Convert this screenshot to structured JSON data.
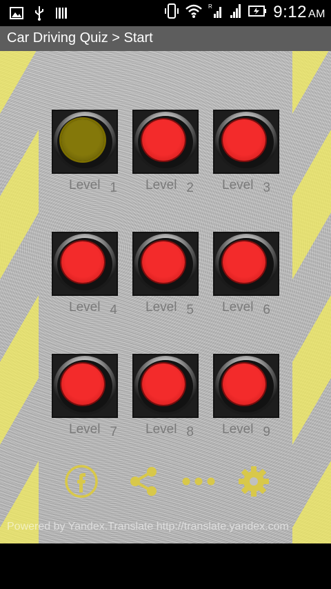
{
  "status_bar": {
    "time": "9:12",
    "ampm": "AM",
    "left_icons": [
      "image-icon",
      "usb-icon",
      "barcode-icon"
    ],
    "right_icons": [
      "vibrate-icon",
      "wifi-icon",
      "signal-icon",
      "signal-icon-2",
      "battery-icon"
    ]
  },
  "title_bar": {
    "title": "Car Driving Quiz > Start"
  },
  "levels": [
    {
      "label": "Level",
      "number": "1",
      "active": true
    },
    {
      "label": "Level",
      "number": "2",
      "active": false
    },
    {
      "label": "Level",
      "number": "3",
      "active": false
    },
    {
      "label": "Level",
      "number": "4",
      "active": false
    },
    {
      "label": "Level",
      "number": "5",
      "active": false
    },
    {
      "label": "Level",
      "number": "6",
      "active": false
    },
    {
      "label": "Level",
      "number": "7",
      "active": false
    },
    {
      "label": "Level",
      "number": "8",
      "active": false
    },
    {
      "label": "Level",
      "number": "9",
      "active": false
    }
  ],
  "bottom_icons": [
    "facebook-icon",
    "share-icon",
    "more-icon",
    "settings-icon"
  ],
  "attribution": "Powered by Yandex.Translate http://translate.yandex.com",
  "colors": {
    "lamp_red": "#f32b2b",
    "lamp_active": "#84780a",
    "icon_yellow": "#d8c84a",
    "title_bg": "#5d5d5d"
  }
}
